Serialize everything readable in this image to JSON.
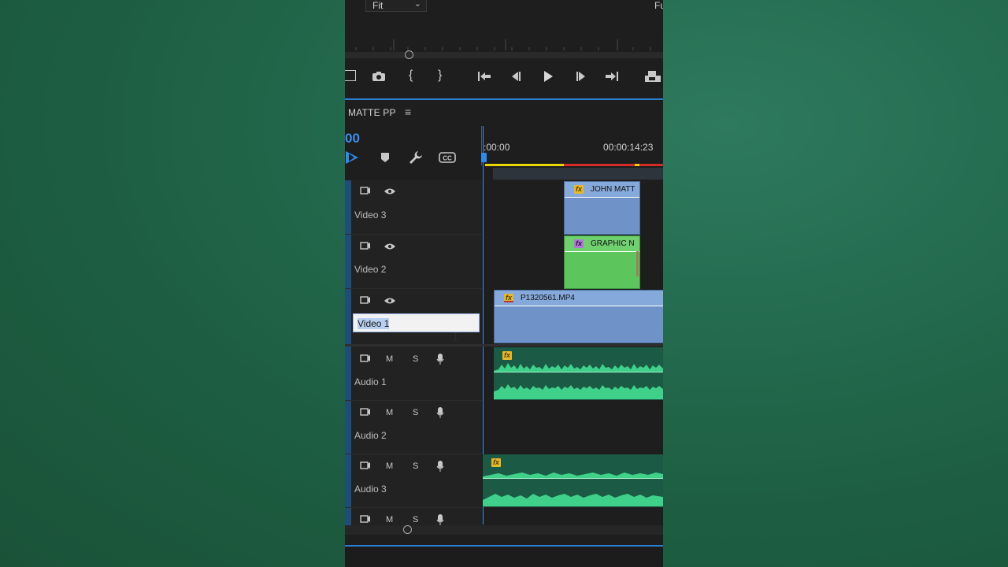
{
  "monitor": {
    "zoom_value": "Fit",
    "resolution_value": "Fu"
  },
  "transport": {
    "buttons": [
      "insert-icon",
      "camera-icon",
      "mark-in-icon",
      "mark-out-icon",
      "go-to-in-icon",
      "step-back-icon",
      "play-icon",
      "step-forward-icon",
      "go-to-out-icon",
      "export-frame-icon"
    ]
  },
  "timeline": {
    "sequence_name": "MATTE PP",
    "timecode": "00",
    "ruler_start": ":00:00",
    "ruler_end": "00:00:14:23"
  },
  "tracks": {
    "video": [
      {
        "name": "Video 3"
      },
      {
        "name": "Video 2"
      },
      {
        "name": "Video 1",
        "editing": true
      }
    ],
    "audio": [
      {
        "name": "Audio 1",
        "mute": "M",
        "solo": "S"
      },
      {
        "name": "Audio 2",
        "mute": "M",
        "solo": "S"
      },
      {
        "name": "Audio 3",
        "mute": "M",
        "solo": "S"
      },
      {
        "name": "",
        "mute": "M",
        "solo": "S"
      }
    ]
  },
  "clips": {
    "v3": {
      "title": "JOHN MATT",
      "fx": "fx"
    },
    "v2": {
      "title": "GRAPHIC N",
      "fx": "fx"
    },
    "v1": {
      "title": "P1320561.MP4",
      "fx": "fx"
    },
    "a1": {
      "fx": "fx"
    },
    "a3": {
      "fx": "fx"
    }
  },
  "colors": {
    "app_bg": "#1e1e1e",
    "accent_blue": "#2d8ceb",
    "clip_blue": "#6f93c9",
    "clip_green": "#5cc55b",
    "waveform_green": "#3fd08a",
    "backdrop_green": "#246b4f"
  }
}
